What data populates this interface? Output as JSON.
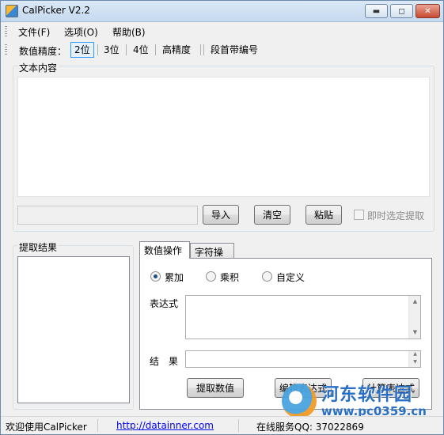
{
  "window": {
    "title": "CalPicker  V2.2",
    "controls": {
      "minimize": "▬",
      "maximize": "◻",
      "close": "✕"
    }
  },
  "menu": {
    "items": [
      {
        "label": "文件(F)"
      },
      {
        "label": "选项(O)"
      },
      {
        "label": "帮助(B)"
      }
    ]
  },
  "toolbar": {
    "precision_label": "数值精度：",
    "buttons": [
      {
        "label": "2位",
        "active": true
      },
      {
        "label": "3位",
        "active": false
      },
      {
        "label": "4位",
        "active": false
      },
      {
        "label": "高精度",
        "active": false
      },
      {
        "label": "段首带编号",
        "active": false
      }
    ]
  },
  "text_content": {
    "group_title": "文本内容",
    "text": "",
    "input_value": "",
    "import_button": "导入",
    "clear_button": "清空",
    "paste_button": "粘贴",
    "auto_extract_checkbox": {
      "label": "即时选定提取",
      "checked": false,
      "enabled": false
    }
  },
  "extract_result": {
    "group_title": "提取结果",
    "items": []
  },
  "tabs": {
    "items": [
      {
        "label": "数值操作",
        "active": true
      },
      {
        "label": "字符操作",
        "active": false
      }
    ],
    "numeric": {
      "modes": [
        {
          "label": "累加",
          "checked": true
        },
        {
          "label": "乘积",
          "checked": false
        },
        {
          "label": "自定义",
          "checked": false
        }
      ],
      "expression_label": "表达式",
      "expression_value": "",
      "result_label": "结　果",
      "result_value": "",
      "extract_button": "提取数值",
      "edit_expression_button": "编辑表达式",
      "calc_expression_button": "计算表达式"
    }
  },
  "statusbar": {
    "welcome": "欢迎使用CalPicker",
    "link": "http://datainner.com",
    "qq": "在线服务QQ: 37022869"
  },
  "watermark": {
    "title": "河东软件园",
    "url": "www.pc0359.cn"
  }
}
